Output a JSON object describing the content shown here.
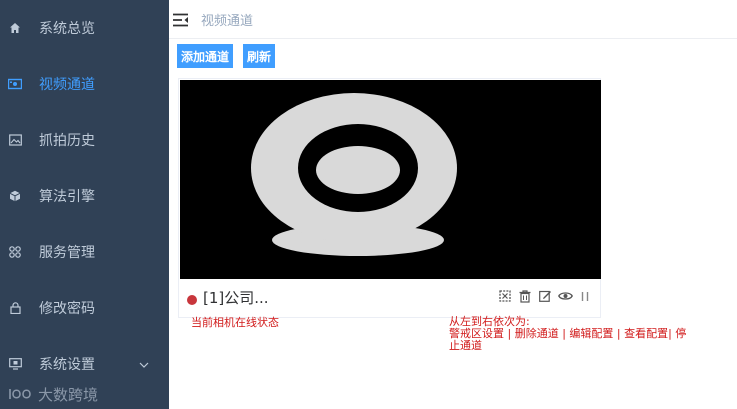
{
  "sidebar": {
    "items": [
      {
        "label": "系统总览",
        "icon": "home-icon"
      },
      {
        "label": "视频通道",
        "icon": "video-channel-icon",
        "active": true
      },
      {
        "label": "抓拍历史",
        "icon": "image-icon"
      },
      {
        "label": "算法引擎",
        "icon": "cube-icon"
      },
      {
        "label": "服务管理",
        "icon": "grid-icon"
      },
      {
        "label": "修改密码",
        "icon": "lock-icon"
      },
      {
        "label": "系统设置",
        "icon": "monitor-icon",
        "has_submenu": true
      }
    ],
    "brand": "大数跨境"
  },
  "header": {
    "breadcrumb": "视频通道"
  },
  "toolbar": {
    "add_label": "添加通道",
    "refresh_label": "刷新"
  },
  "card": {
    "name": "[1]公司...",
    "status": "offline",
    "actions": [
      "alarm-zone-icon",
      "delete-icon",
      "edit-icon",
      "view-icon",
      "stop-icon"
    ]
  },
  "annotations": {
    "status_note": "当前相机在线状态",
    "actions_title": "从左到右依次为:",
    "actions_line1": "警戒区设置 | 删除通道 | 编辑配置 | 查看配置| 停",
    "actions_line2": "止通道"
  },
  "colors": {
    "sidebar_bg": "#304156",
    "accent": "#409eff",
    "status_dot": "#c8363c",
    "annotation": "#d11a1a"
  }
}
